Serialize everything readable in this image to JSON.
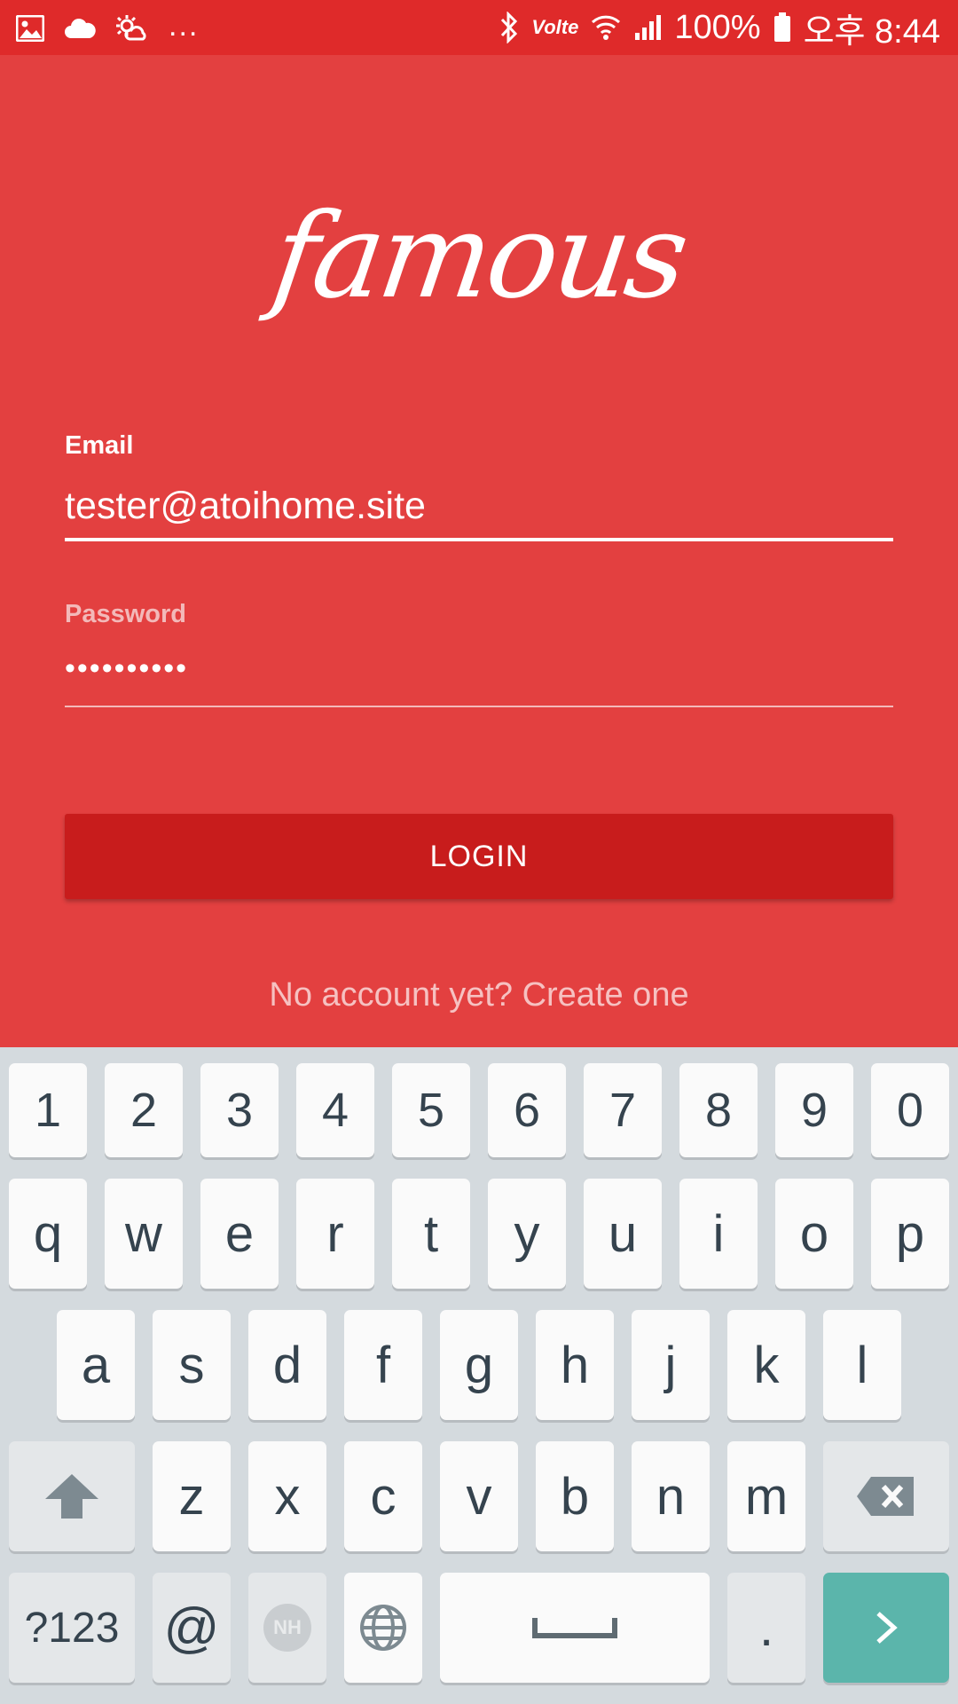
{
  "status_bar": {
    "notification_icons": [
      "image-icon",
      "cloud-icon",
      "weather-icon"
    ],
    "overflow": "...",
    "network": "Volte",
    "battery": "100%",
    "time": "오후 8:44"
  },
  "app": {
    "logo": "famous",
    "email": {
      "label": "Email",
      "value": "tester@atoihome.site"
    },
    "password": {
      "label": "Password",
      "value": "••••••••••"
    },
    "login_button": "LOGIN",
    "create_account": "No account yet? Create one",
    "colors": {
      "background": "#e34040",
      "status_bar": "#df2a2a",
      "button": "#c81c1c",
      "link": "#f6c1c1"
    }
  },
  "keyboard": {
    "row_numbers": [
      "1",
      "2",
      "3",
      "4",
      "5",
      "6",
      "7",
      "8",
      "9",
      "0"
    ],
    "row_top": [
      "q",
      "w",
      "e",
      "r",
      "t",
      "y",
      "u",
      "i",
      "o",
      "p"
    ],
    "row_middle": [
      "a",
      "s",
      "d",
      "f",
      "g",
      "h",
      "j",
      "k",
      "l"
    ],
    "row_bottom": [
      "z",
      "x",
      "c",
      "v",
      "b",
      "n",
      "m"
    ],
    "symbols_key": "?123",
    "at_key": "@",
    "nh_key": "NH",
    "period_key": ".",
    "icons": {
      "shift": "shift-icon",
      "backspace": "backspace-icon",
      "language": "globe-icon",
      "space": "space-icon",
      "enter": "next-arrow-icon"
    },
    "colors": {
      "background": "#d4dade",
      "key": "#fafafa",
      "key_text": "#35434e",
      "enter": "#5bb5ab"
    }
  }
}
